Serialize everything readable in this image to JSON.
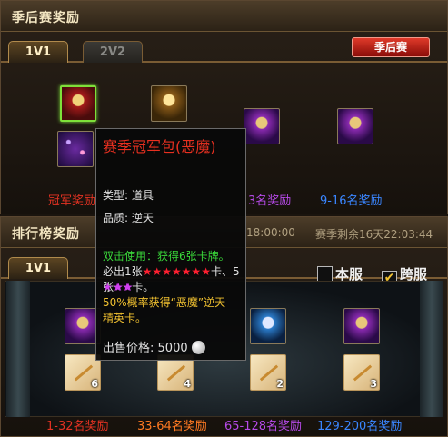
{
  "season_panel": {
    "title": "季后赛奖励",
    "tabs": [
      "1V1",
      "2V2"
    ],
    "playoff_button": "季后赛",
    "labels": [
      "冠军奖励",
      "3名奖励",
      "9-16名奖励"
    ]
  },
  "rank_panel": {
    "title": "排行榜奖励",
    "time_left_partial": "18:00:00",
    "season_remaining": "赛季剩余16天22:03:44",
    "tabs": [
      "1V1"
    ],
    "checkbox_local": "本服",
    "checkbox_cross": "跨服",
    "counts": [
      "6",
      "4",
      "2",
      "3"
    ],
    "labels": [
      "1-32名奖励",
      "33-64名奖励",
      "65-128名奖励",
      "129-200名奖励"
    ]
  },
  "tooltip": {
    "title": "赛季冠军包(恶魔)",
    "type": "类型: 道具",
    "quality": "品质: 逆天",
    "usage": "双击使用：获得6张卡牌。",
    "line_must_a": "必出1张",
    "stars_red": "★★★★★★★",
    "line_must_b": "卡、5张",
    "stars_purple_a": "★★",
    "stars_purple_b": "★★★",
    "line_must_c": "卡。",
    "chance_a": "50%概率获得“恶魔”逆天",
    "chance_b": "精英卡。",
    "price_label": "出售价格:",
    "price_value": "5000"
  },
  "colors": {
    "red": "#e23222",
    "orange": "#ff7a22",
    "purple": "#b64ae8",
    "blue": "#3a86ff",
    "accent": "#7ee03a"
  }
}
